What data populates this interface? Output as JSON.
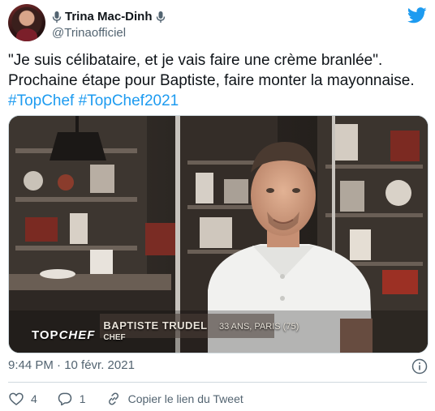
{
  "author": {
    "display_name": "Trina Mac-Dinh",
    "handle": "@Trinaofficiel",
    "icons": [
      "microphone-icon",
      "twitter-bird-icon"
    ]
  },
  "tweet": {
    "line1": "\"Je suis célibataire, et je vais faire une crème branlée\".",
    "line2": "Prochaine étape pour Baptiste, faire monter la mayonnaise.",
    "hashtags": [
      "#TopChef",
      "#TopChef2021"
    ]
  },
  "media": {
    "logo_top": "TOP",
    "logo_chef": "CHEF",
    "name": "BAPTISTE TRUDEL",
    "info": "33 ANS, PARIS (75)",
    "role": "CHEF"
  },
  "meta": {
    "time_date": "9:44 PM · 10 févr. 2021"
  },
  "actions": {
    "likes": "4",
    "replies": "1",
    "copy_link": "Copier le lien du Tweet"
  },
  "colors": {
    "accent": "#1d9bf0",
    "text": "#0f1419",
    "muted": "#536471",
    "border": "#cfd9de"
  }
}
